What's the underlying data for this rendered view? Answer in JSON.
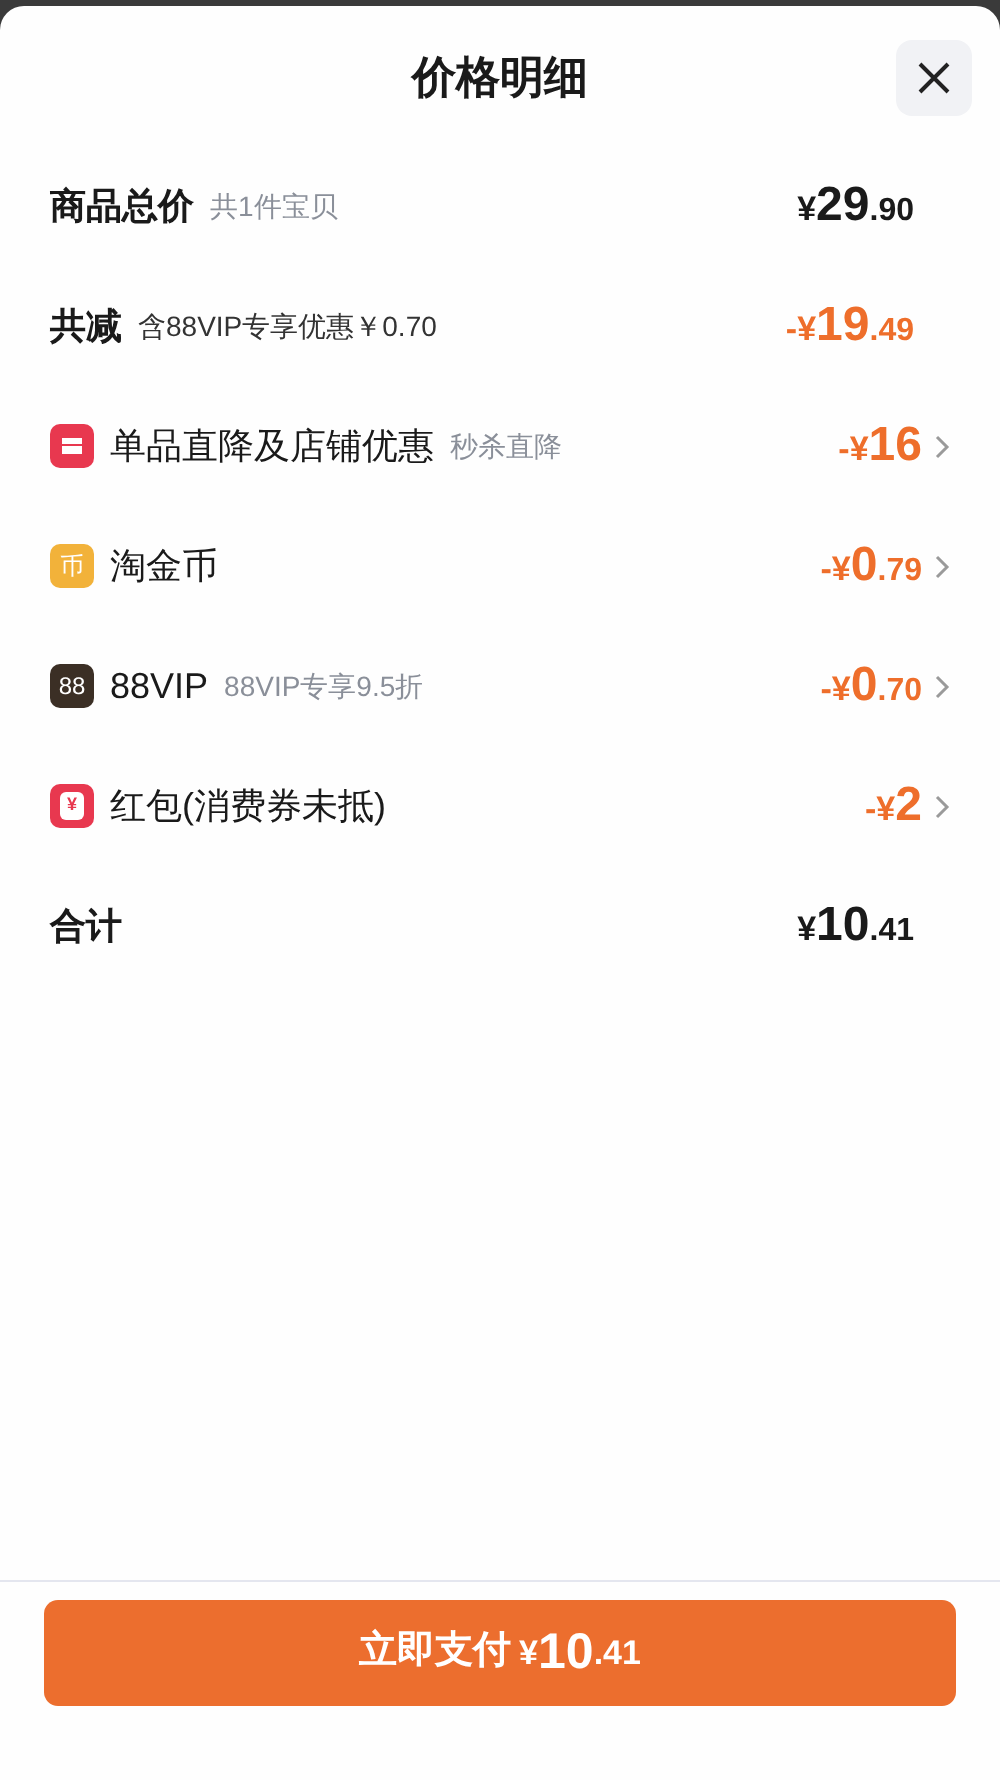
{
  "title": "价格明细",
  "rows": [
    {
      "kind": "summary",
      "label": "商品总价",
      "note": "共1件宝贝",
      "amount": {
        "prefix": "¥",
        "main": "29",
        "fraction": ".90"
      },
      "discount": false
    },
    {
      "kind": "summary",
      "label": "共减",
      "note": "含88VIP专享优惠￥0.70",
      "amount": {
        "prefix": "-¥",
        "main": "19",
        "fraction": ".49"
      },
      "discount": true
    },
    {
      "kind": "store",
      "color": "#e8384f",
      "label": "单品直降及店铺优惠",
      "note": "秒杀直降",
      "amount": {
        "prefix": "-¥",
        "main": "16"
      },
      "discount": true
    },
    {
      "kind": "glyph",
      "icon_text": "币",
      "color": "#f2b23a",
      "label": "淘金币",
      "amount": {
        "prefix": "-¥",
        "main": "0",
        "fraction": ".79"
      },
      "discount": true
    },
    {
      "kind": "glyph",
      "icon_text": "88",
      "color": "#3b2f25",
      "label": "88VIP",
      "note": "88VIP专享9.5折",
      "amount": {
        "prefix": "-¥",
        "main": "0",
        "fraction": ".70"
      },
      "discount": true
    },
    {
      "kind": "packet",
      "icon_text": "¥",
      "color": "#e8384f",
      "label": "红包(消费券未抵)",
      "amount": {
        "prefix": "-¥",
        "main": "2"
      },
      "discount": true
    },
    {
      "kind": "summary",
      "label": "合计",
      "amount": {
        "prefix": "¥",
        "main": "10",
        "fraction": ".41"
      },
      "discount": false
    }
  ],
  "pay_button": {
    "label": "立即支付",
    "amount": {
      "prefix": "¥",
      "main": "10",
      "fraction": ".41"
    }
  }
}
